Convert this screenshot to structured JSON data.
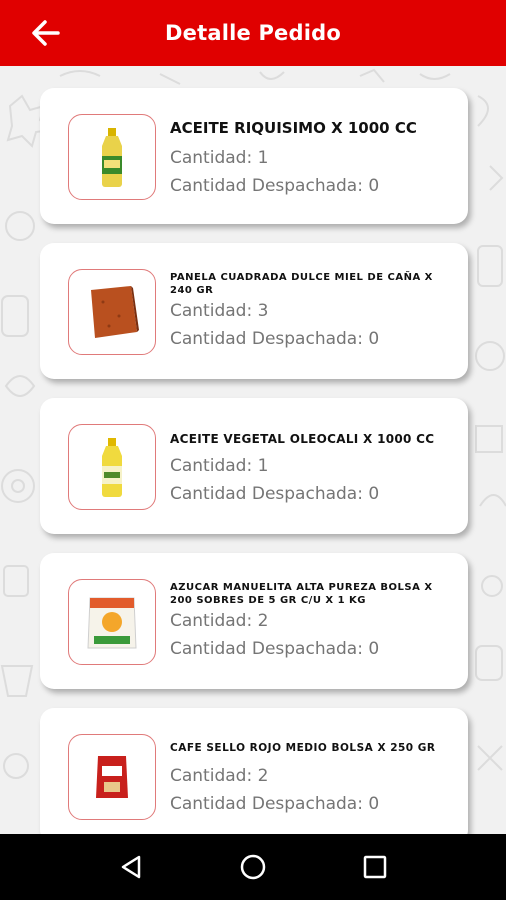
{
  "header": {
    "title": "Detalle Pedido",
    "back_icon": "arrow-left-icon",
    "color": "#e00000"
  },
  "items": [
    {
      "name": "ACEITE RIQUISIMO X 1000 CC",
      "quantity": "Cantidad: 1",
      "dispatched": "Cantidad Despachada: 0",
      "image": "oil-bottle-image"
    },
    {
      "name": "PANELA CUADRADA DULCE MIEL DE CAÑA X 240 GR",
      "quantity": "Cantidad: 3",
      "dispatched": "Cantidad Despachada: 0",
      "image": "panela-block-image"
    },
    {
      "name": "ACEITE VEGETAL OLEOCALI X 1000 CC",
      "quantity": "Cantidad: 1",
      "dispatched": "Cantidad Despachada: 0",
      "image": "oil-bottle-image"
    },
    {
      "name": "AZUCAR MANUELITA ALTA PUREZA BOLSA X 200 SOBRES DE 5 GR C/U X 1 KG",
      "quantity": "Cantidad: 2",
      "dispatched": "Cantidad Despachada: 0",
      "image": "sugar-bag-image"
    },
    {
      "name": "CAFE SELLO ROJO MEDIO BOLSA X 250 GR",
      "quantity": "Cantidad: 2",
      "dispatched": "Cantidad Despachada: 0",
      "image": "coffee-bag-image"
    }
  ],
  "navigation": {
    "back": "triangle-back-icon",
    "home": "circle-home-icon",
    "recents": "square-recents-icon"
  }
}
